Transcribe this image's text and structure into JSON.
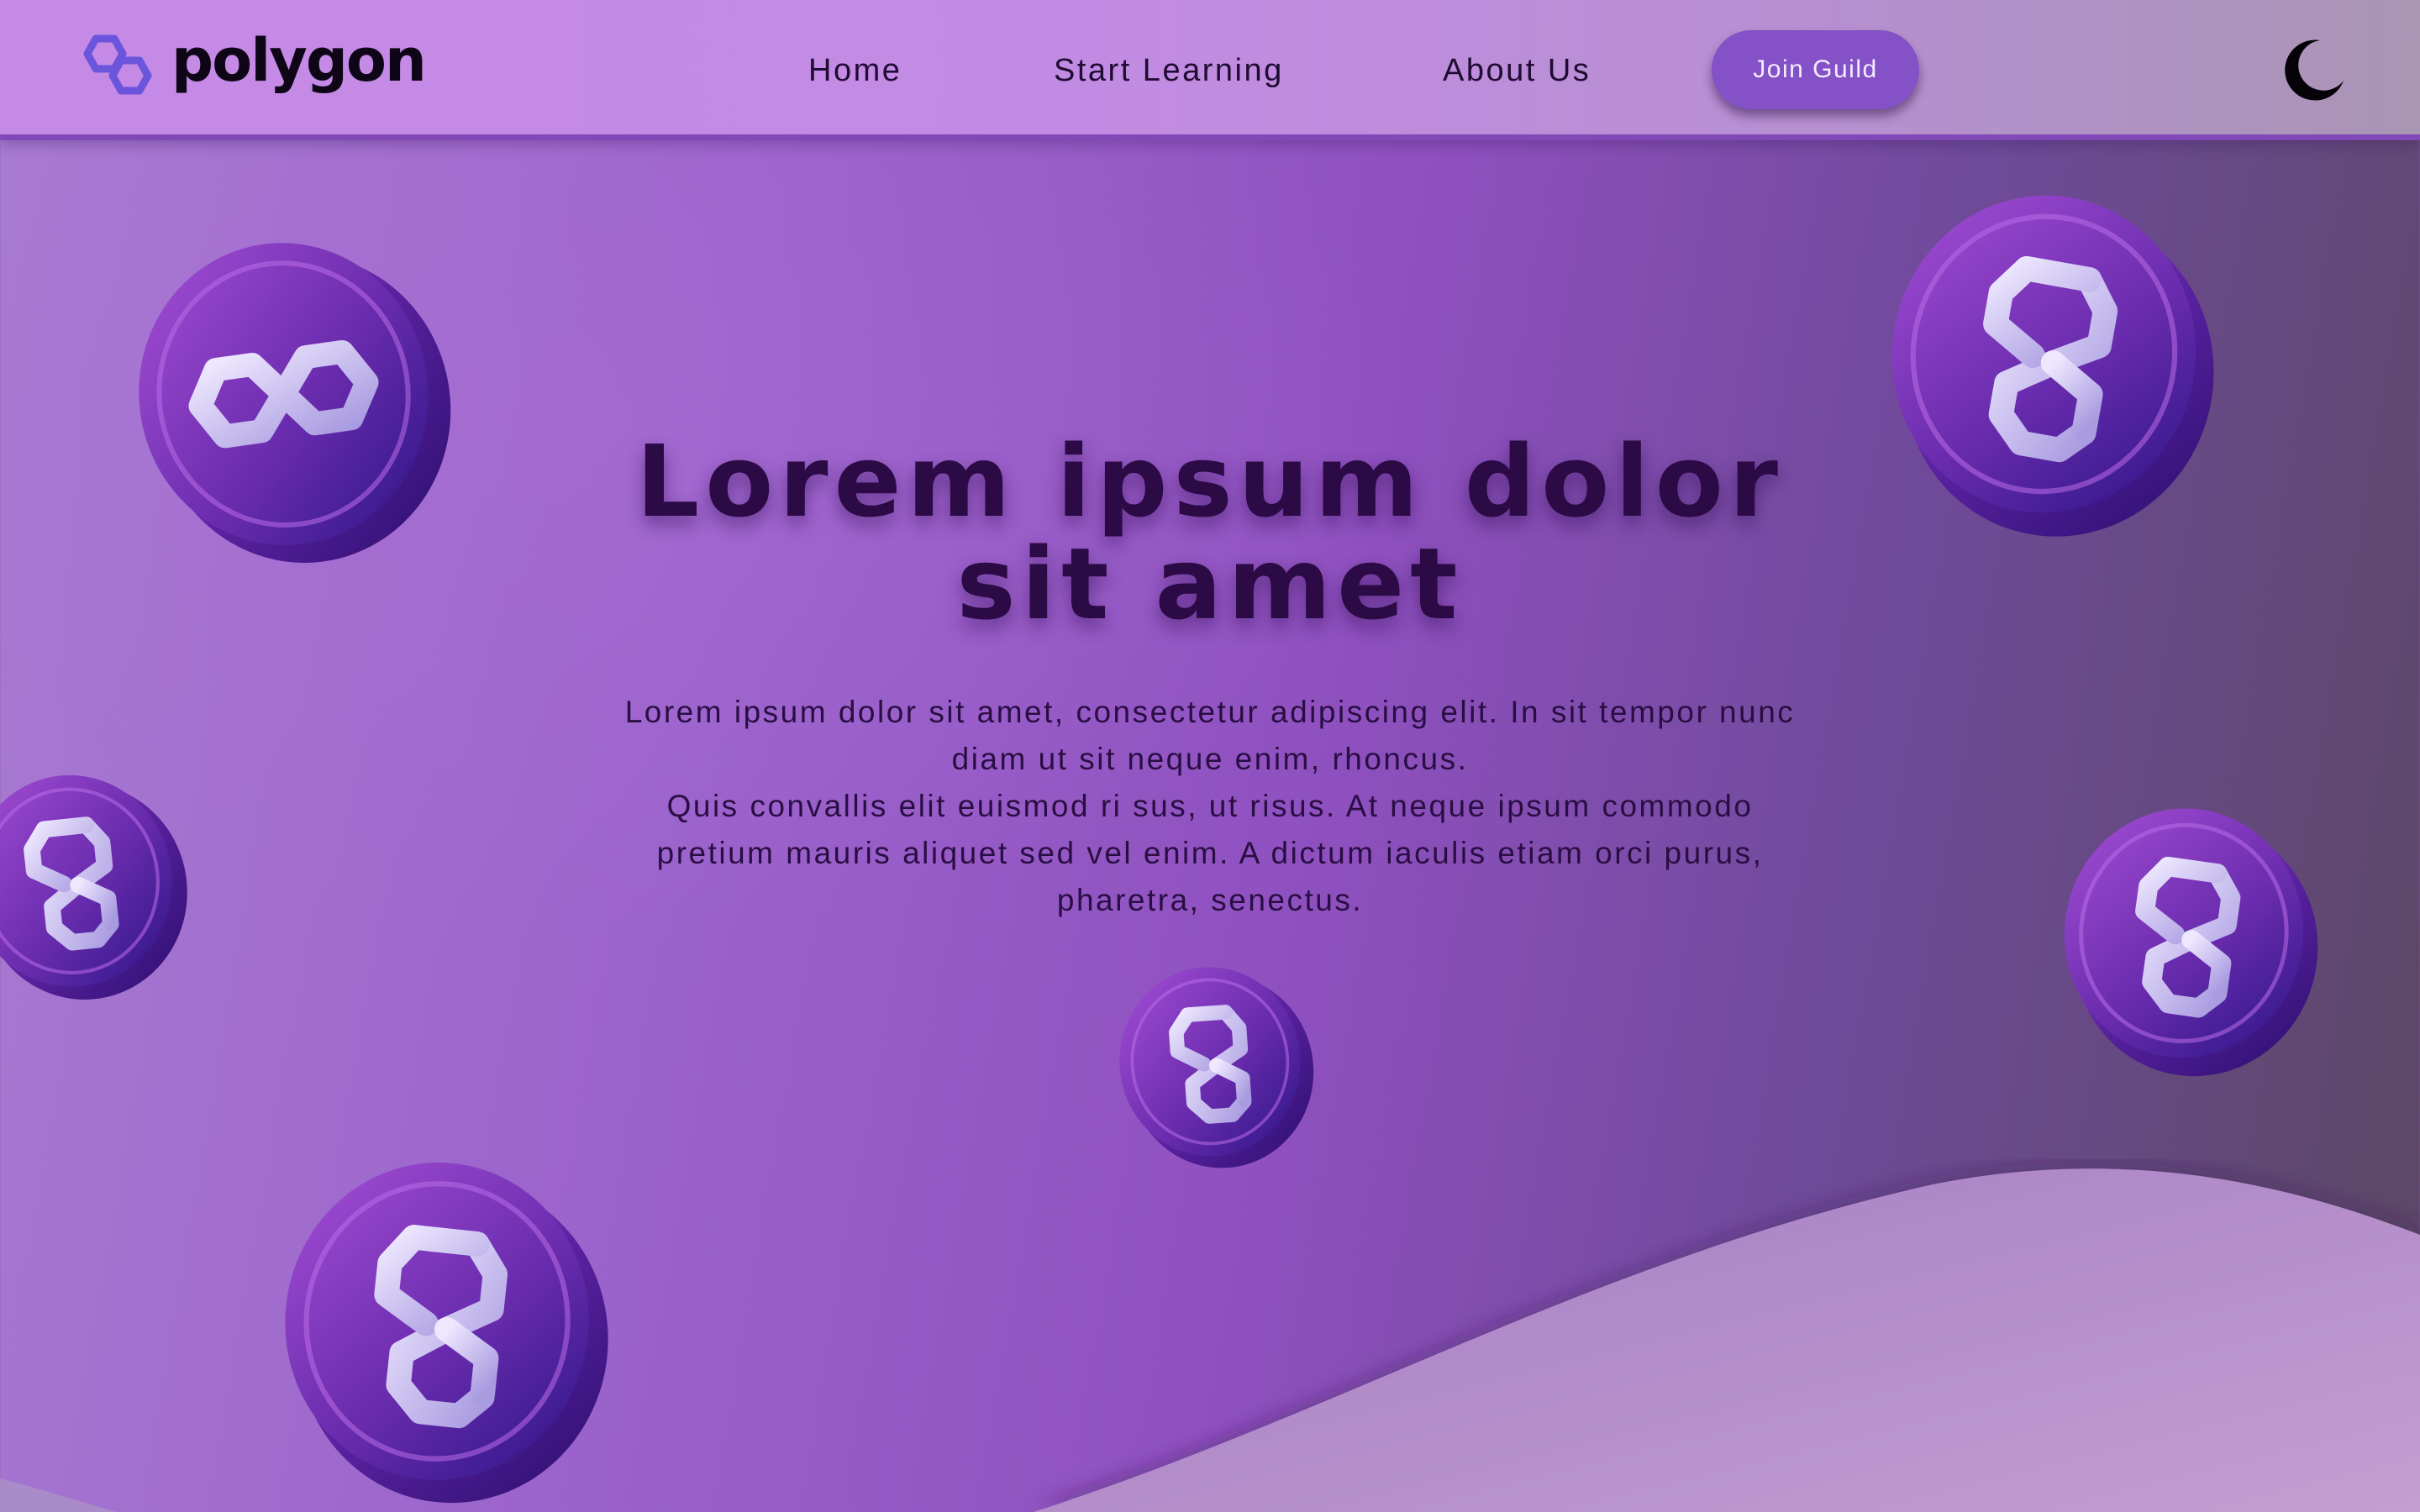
{
  "header": {
    "brand": "polygon",
    "logo_icon": "polygon-logo-icon",
    "nav": [
      {
        "label": "Home"
      },
      {
        "label": "Start Learning"
      },
      {
        "label": "About Us"
      }
    ],
    "cta_label": "Join Guild",
    "theme_toggle_icon": "moon-icon"
  },
  "hero": {
    "title": "Lorem ipsum dolor sit amet",
    "paragraph_1": "Lorem ipsum dolor sit amet, consectetur adipiscing elit. In sit tempor nunc diam ut sit neque enim, rhoncus.",
    "paragraph_2": "Quis convallis elit euismod ri sus, ut risus. At neque ipsum commodo pretium mauris aliquet sed vel enim. A dictum iaculis etiam orci purus, pharetra, senectus."
  },
  "decorations": {
    "coin_icon": "polygon-coin-icon",
    "coin_count": 6
  },
  "colors": {
    "accent": "#8452c6",
    "nav_border": "#8148b8",
    "title_text": "#2b0a45",
    "background_start": "#a97cd1",
    "background_end": "#5a4862"
  }
}
